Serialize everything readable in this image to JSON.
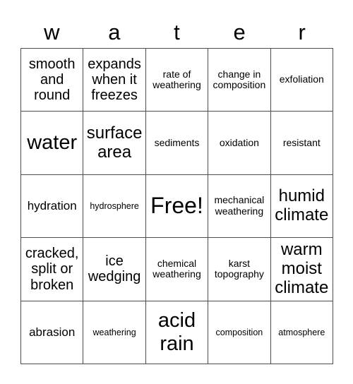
{
  "card": {
    "header_letters": [
      "w",
      "a",
      "t",
      "e",
      "r"
    ],
    "border_color": "#4d4d4d",
    "background_color": "#ffffff",
    "text_color": "#000000",
    "rows": 5,
    "columns": 5,
    "cells": [
      {
        "text": "smooth and round",
        "size": "l",
        "marked": false
      },
      {
        "text": "expands when it freezes",
        "size": "l",
        "marked": false
      },
      {
        "text": "rate of weathering",
        "size": "s",
        "marked": false
      },
      {
        "text": "change in composition",
        "size": "s",
        "marked": false
      },
      {
        "text": "exfoliation",
        "size": "s",
        "marked": false
      },
      {
        "text": "water",
        "size": "xxl",
        "marked": false
      },
      {
        "text": "surface area",
        "size": "xl",
        "marked": false
      },
      {
        "text": "sediments",
        "size": "s",
        "marked": false
      },
      {
        "text": "oxidation",
        "size": "s",
        "marked": false
      },
      {
        "text": "resistant",
        "size": "s",
        "marked": false
      },
      {
        "text": "hydration",
        "size": "m",
        "marked": false
      },
      {
        "text": "hydrosphere",
        "size": "xs",
        "marked": false
      },
      {
        "text": "Free!",
        "size": "free",
        "marked": false
      },
      {
        "text": "mechanical weathering",
        "size": "s",
        "marked": false
      },
      {
        "text": "humid climate",
        "size": "xl",
        "marked": false
      },
      {
        "text": "cracked, split or broken",
        "size": "l",
        "marked": false
      },
      {
        "text": "ice wedging",
        "size": "l",
        "marked": false
      },
      {
        "text": "chemical weathering",
        "size": "s",
        "marked": false
      },
      {
        "text": "karst topography",
        "size": "s",
        "marked": false
      },
      {
        "text": "warm moist climate",
        "size": "xl",
        "marked": false
      },
      {
        "text": "abrasion",
        "size": "m",
        "marked": false
      },
      {
        "text": "weathering",
        "size": "xs",
        "marked": false
      },
      {
        "text": "acid rain",
        "size": "xxl",
        "marked": false
      },
      {
        "text": "composition",
        "size": "xs",
        "marked": false
      },
      {
        "text": "atmosphere",
        "size": "xs",
        "marked": false
      }
    ]
  }
}
